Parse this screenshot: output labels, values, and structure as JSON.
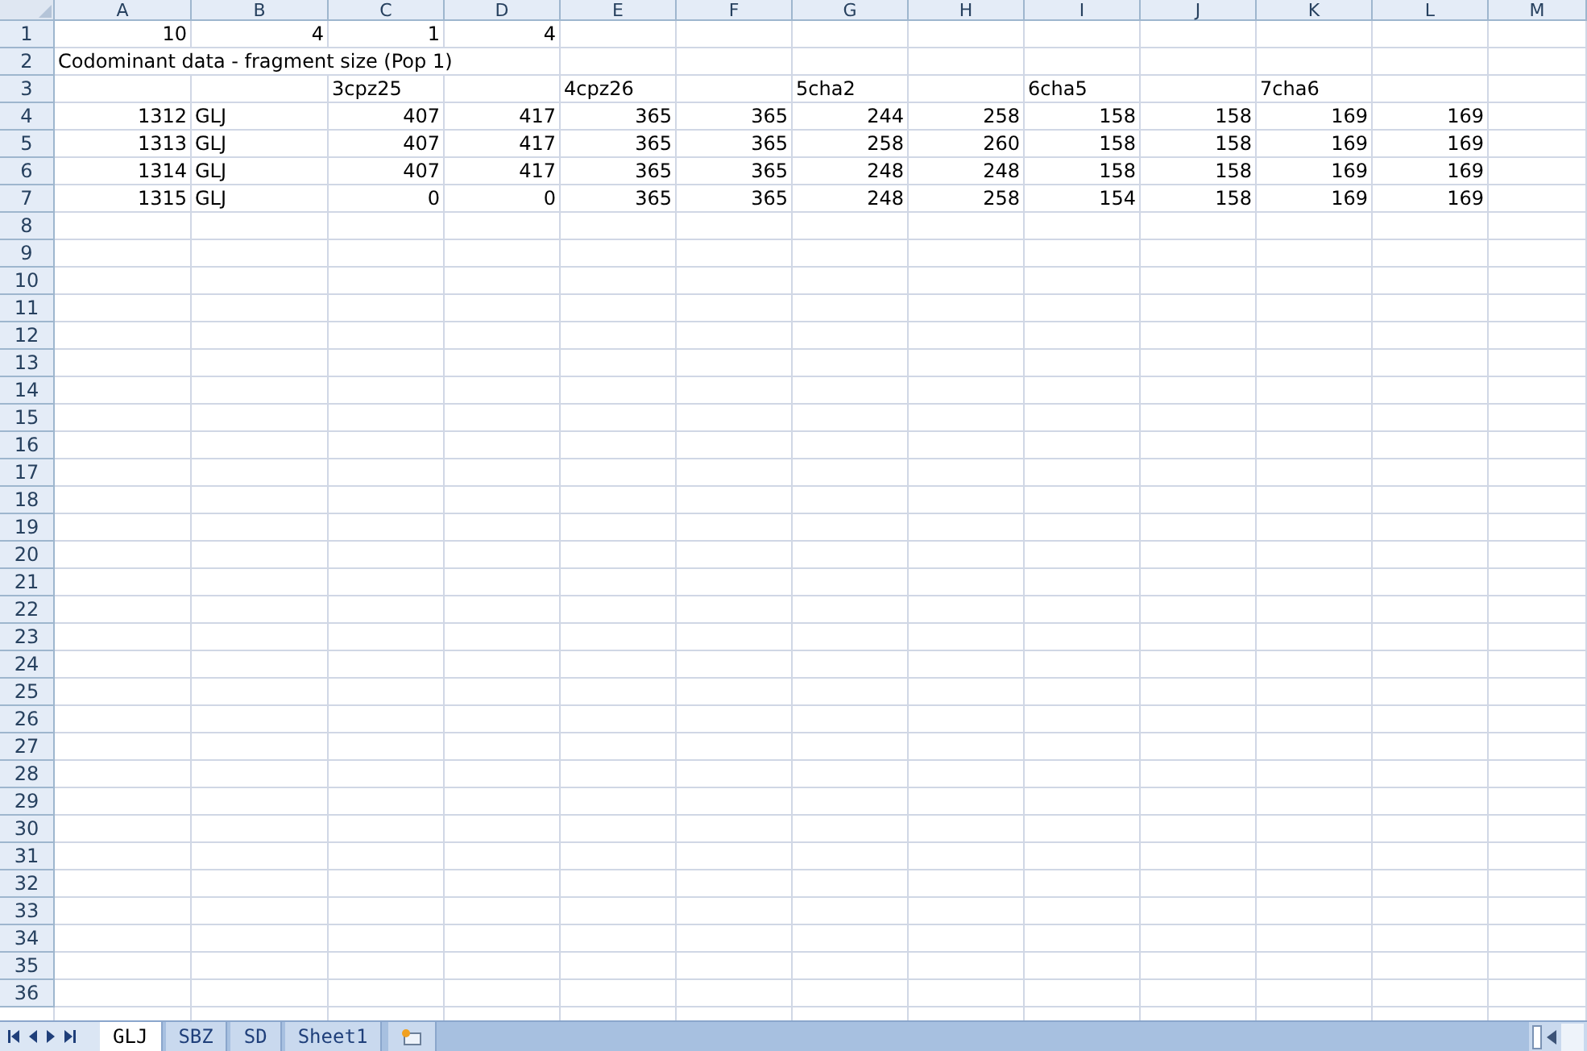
{
  "columns": [
    "A",
    "B",
    "C",
    "D",
    "E",
    "F",
    "G",
    "H",
    "I",
    "J",
    "K",
    "L",
    "M"
  ],
  "rows": [
    {
      "label": "1",
      "cells": [
        {
          "kind": "number",
          "text": "10"
        },
        {
          "kind": "number",
          "text": "4"
        },
        {
          "kind": "number",
          "text": "1"
        },
        {
          "kind": "number",
          "text": "4"
        }
      ]
    },
    {
      "label": "2",
      "cells": [
        {
          "kind": "text",
          "text": "Codominant data - fragment size (Pop 1)"
        }
      ]
    },
    {
      "label": "3",
      "cells": [
        {
          "kind": "empty"
        },
        {
          "kind": "empty"
        },
        {
          "kind": "text",
          "text": "3cpz25"
        },
        {
          "kind": "empty"
        },
        {
          "kind": "text",
          "text": "4cpz26"
        },
        {
          "kind": "empty"
        },
        {
          "kind": "text",
          "text": "5cha2"
        },
        {
          "kind": "empty"
        },
        {
          "kind": "text",
          "text": "6cha5"
        },
        {
          "kind": "empty"
        },
        {
          "kind": "text",
          "text": "7cha6"
        }
      ]
    },
    {
      "label": "4",
      "cells": [
        {
          "kind": "number",
          "text": "1312"
        },
        {
          "kind": "text",
          "text": "GLJ"
        },
        {
          "kind": "number",
          "text": "407"
        },
        {
          "kind": "number",
          "text": "417"
        },
        {
          "kind": "number",
          "text": "365"
        },
        {
          "kind": "number",
          "text": "365"
        },
        {
          "kind": "number",
          "text": "244"
        },
        {
          "kind": "number",
          "text": "258"
        },
        {
          "kind": "number",
          "text": "158"
        },
        {
          "kind": "number",
          "text": "158"
        },
        {
          "kind": "number",
          "text": "169"
        },
        {
          "kind": "number",
          "text": "169"
        }
      ]
    },
    {
      "label": "5",
      "cells": [
        {
          "kind": "number",
          "text": "1313"
        },
        {
          "kind": "text",
          "text": "GLJ"
        },
        {
          "kind": "number",
          "text": "407"
        },
        {
          "kind": "number",
          "text": "417"
        },
        {
          "kind": "number",
          "text": "365"
        },
        {
          "kind": "number",
          "text": "365"
        },
        {
          "kind": "number",
          "text": "258"
        },
        {
          "kind": "number",
          "text": "260"
        },
        {
          "kind": "number",
          "text": "158"
        },
        {
          "kind": "number",
          "text": "158"
        },
        {
          "kind": "number",
          "text": "169"
        },
        {
          "kind": "number",
          "text": "169"
        }
      ]
    },
    {
      "label": "6",
      "cells": [
        {
          "kind": "number",
          "text": "1314"
        },
        {
          "kind": "text",
          "text": "GLJ"
        },
        {
          "kind": "number",
          "text": "407"
        },
        {
          "kind": "number",
          "text": "417"
        },
        {
          "kind": "number",
          "text": "365"
        },
        {
          "kind": "number",
          "text": "365"
        },
        {
          "kind": "number",
          "text": "248"
        },
        {
          "kind": "number",
          "text": "248"
        },
        {
          "kind": "number",
          "text": "158"
        },
        {
          "kind": "number",
          "text": "158"
        },
        {
          "kind": "number",
          "text": "169"
        },
        {
          "kind": "number",
          "text": "169"
        }
      ]
    },
    {
      "label": "7",
      "cells": [
        {
          "kind": "number",
          "text": "1315"
        },
        {
          "kind": "text",
          "text": "GLJ"
        },
        {
          "kind": "number",
          "text": "0"
        },
        {
          "kind": "number",
          "text": "0"
        },
        {
          "kind": "number",
          "text": "365"
        },
        {
          "kind": "number",
          "text": "365"
        },
        {
          "kind": "number",
          "text": "248"
        },
        {
          "kind": "number",
          "text": "258"
        },
        {
          "kind": "number",
          "text": "154"
        },
        {
          "kind": "number",
          "text": "158"
        },
        {
          "kind": "number",
          "text": "169"
        },
        {
          "kind": "number",
          "text": "169"
        }
      ]
    },
    {
      "label": "8",
      "cells": []
    },
    {
      "label": "9",
      "cells": []
    },
    {
      "label": "10",
      "cells": []
    },
    {
      "label": "11",
      "cells": []
    },
    {
      "label": "12",
      "cells": []
    },
    {
      "label": "13",
      "cells": []
    },
    {
      "label": "14",
      "cells": []
    },
    {
      "label": "15",
      "cells": []
    },
    {
      "label": "16",
      "cells": []
    },
    {
      "label": "17",
      "cells": []
    },
    {
      "label": "18",
      "cells": []
    },
    {
      "label": "19",
      "cells": []
    },
    {
      "label": "20",
      "cells": []
    },
    {
      "label": "21",
      "cells": []
    },
    {
      "label": "22",
      "cells": []
    },
    {
      "label": "23",
      "cells": []
    },
    {
      "label": "24",
      "cells": []
    },
    {
      "label": "25",
      "cells": []
    },
    {
      "label": "26",
      "cells": []
    },
    {
      "label": "27",
      "cells": []
    },
    {
      "label": "28",
      "cells": []
    },
    {
      "label": "29",
      "cells": []
    },
    {
      "label": "30",
      "cells": []
    },
    {
      "label": "31",
      "cells": []
    },
    {
      "label": "32",
      "cells": []
    },
    {
      "label": "33",
      "cells": []
    },
    {
      "label": "34",
      "cells": []
    },
    {
      "label": "35",
      "cells": []
    },
    {
      "label": "36",
      "cells": []
    }
  ],
  "sheet_tabs": [
    {
      "label": "GLJ",
      "selected": true
    },
    {
      "label": "SBZ",
      "selected": false
    },
    {
      "label": "SD",
      "selected": false
    },
    {
      "label": "Sheet1",
      "selected": false
    }
  ]
}
